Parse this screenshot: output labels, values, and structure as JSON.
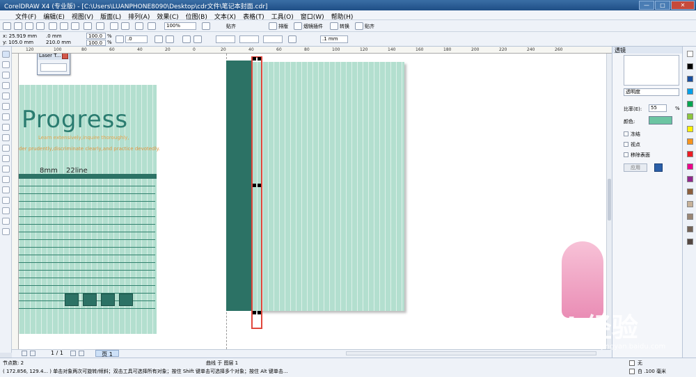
{
  "window": {
    "title": "CorelDRAW X4 (专业版) - [C:\\Users\\LUANPHONE8090\\Desktop\\cdr文件\\笔记本封面.cdr]",
    "buttons": [
      "—",
      "□",
      "✕"
    ]
  },
  "menu": [
    "文件(F)",
    "编辑(E)",
    "视图(V)",
    "版面(L)",
    "排列(A)",
    "效果(C)",
    "位图(B)",
    "文本(X)",
    "表格(T)",
    "工具(O)",
    "窗口(W)",
    "帮助(H)"
  ],
  "toolbar1": {
    "zoom": "100%",
    "snap_label": "贴齐",
    "buttons": [
      "排版",
      "烟镜插件",
      "转换"
    ]
  },
  "property_bar": {
    "x": "x: 25.919 mm",
    "y": "y: 105.0 mm",
    "w": ".0 mm",
    "h": "210.0 mm",
    "scale_x": "100.0",
    "scale_y": "100.0",
    "percent": "%",
    "rotation": ".0",
    "outline": ".1 mm"
  },
  "ruler_labels": [
    "120",
    "100",
    "80",
    "60",
    "40",
    "20",
    "0",
    "20",
    "40",
    "60",
    "80",
    "100",
    "120",
    "140",
    "160",
    "180",
    "200",
    "220",
    "240",
    "260"
  ],
  "laser_toolbar": {
    "title": "Laser T..."
  },
  "cover": {
    "logo": "Progress",
    "tagline1": "Learn extensively,inquire thoroughly,",
    "tagline2": "der prudently,discriminate clearly,and practice devotedly.",
    "spec_size": "8mm",
    "spec_lines": "22line"
  },
  "page_nav": {
    "page_info": "1 / 1",
    "tab": "页 1"
  },
  "docker": {
    "title": "透镜",
    "lens_type": "透明度",
    "rate_label": "比率(E):",
    "rate_value": "55",
    "rate_unit": "%",
    "color_label": "颜色:",
    "color": "#6cc5a2",
    "options": [
      "冻结",
      "视点",
      "移除表面"
    ],
    "apply": "应用"
  },
  "status": {
    "nodes": "节点数: 2",
    "object": "曲线 于 图层 1",
    "coords": "( 172.856, 129.4... ) 单击对象两次可旋转/倾斜；双击工具可选择所有对象；按住 Shift 键单击可选择多个对象；按住 Alt 键单击...",
    "fill": "无",
    "outline": "白 .100 毫米"
  },
  "watermark": {
    "brand": "Bai 经验",
    "url": "jingyan.baidu.com"
  },
  "colors": {
    "dark_teal": "#2c7265",
    "mint": "#b3dfcf",
    "selection": "#e0463b"
  },
  "palette_colors": [
    "#ffffff",
    "#000000",
    "#1a4fa0",
    "#00a0e9",
    "#00a651",
    "#8dc63f",
    "#fff200",
    "#f7941d",
    "#ed1c24",
    "#ec008c",
    "#92278f",
    "#8b5e3c",
    "#c7b299",
    "#998675",
    "#736357",
    "#534741"
  ]
}
